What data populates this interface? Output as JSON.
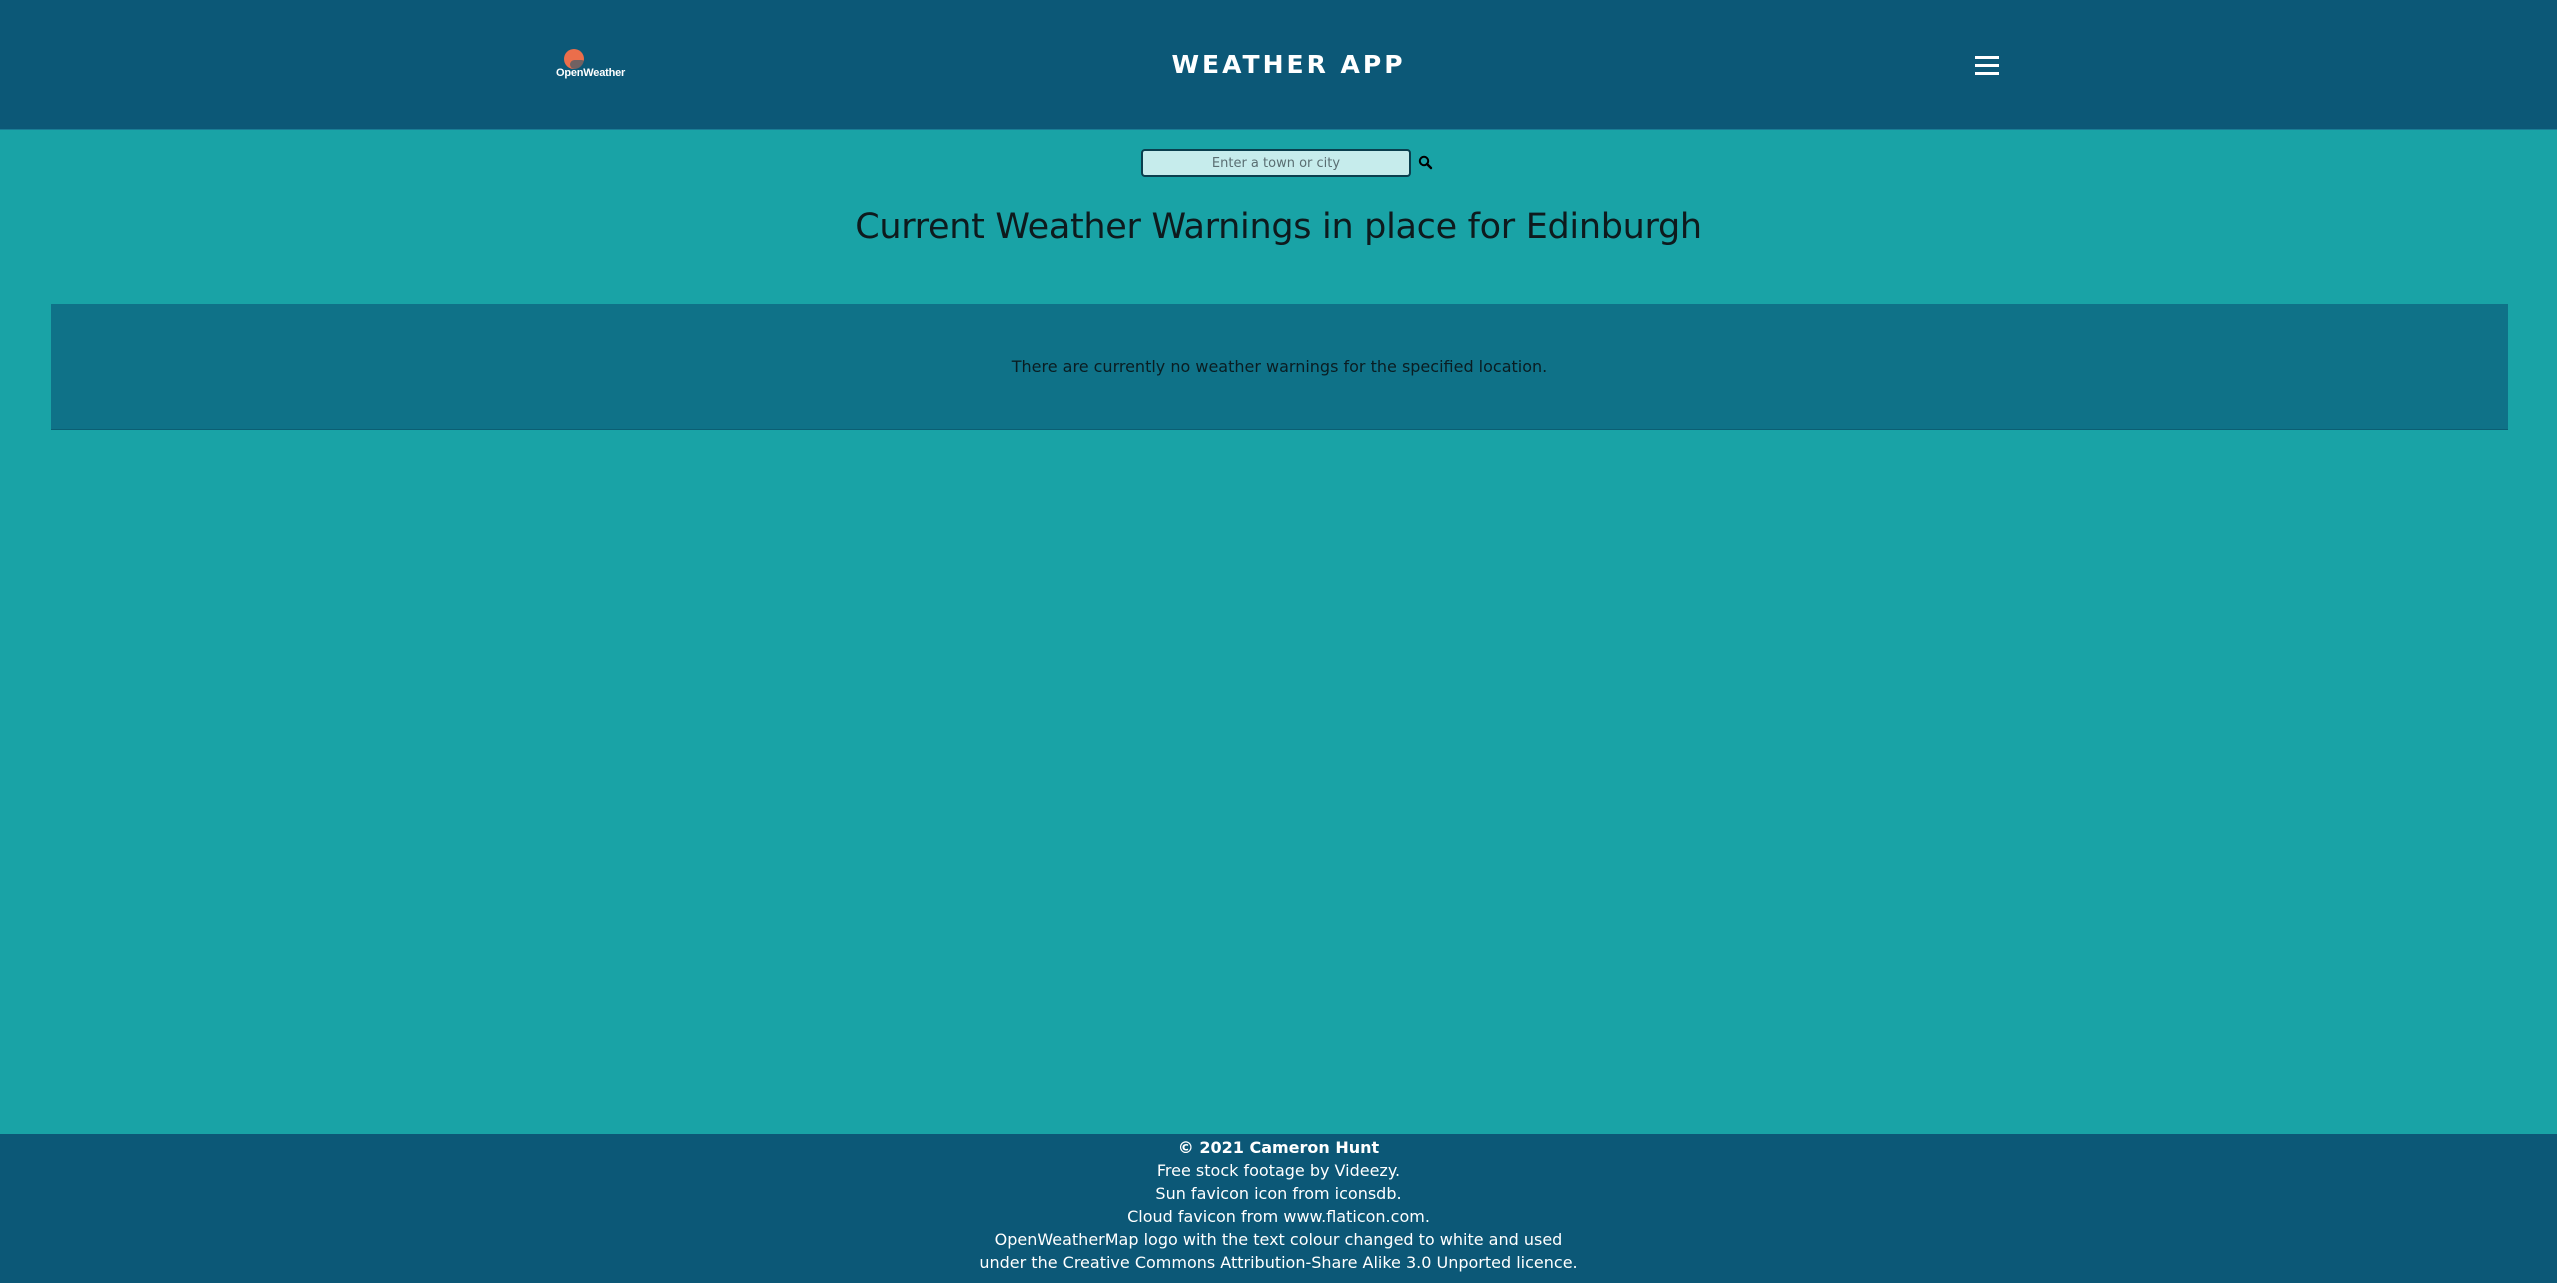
{
  "header": {
    "logo_text": "OpenWeather",
    "title": "WEATHER APP",
    "menu_icon": "hamburger-menu-icon"
  },
  "search": {
    "placeholder": "Enter a town or city",
    "value": "",
    "button_icon": "search-icon"
  },
  "main": {
    "title": "Current Weather Warnings in place for Edinburgh",
    "warning_message": "There are currently no weather warnings for the specified location."
  },
  "footer": {
    "copyright": "© 2021 Cameron Hunt",
    "credits": [
      "Free stock footage by Videezy.",
      "Sun favicon icon from iconsdb.",
      "Cloud favicon from www.flaticon.com.",
      "OpenWeatherMap logo with the text colour changed to white and used",
      "under the Creative Commons Attribution-Share Alike 3.0 Unported licence."
    ]
  },
  "colors": {
    "header_bg": "#0c5877",
    "page_bg": "#19a3a6",
    "panel_bg": "#0f7288",
    "logo_sun": "#eb6e4b"
  }
}
